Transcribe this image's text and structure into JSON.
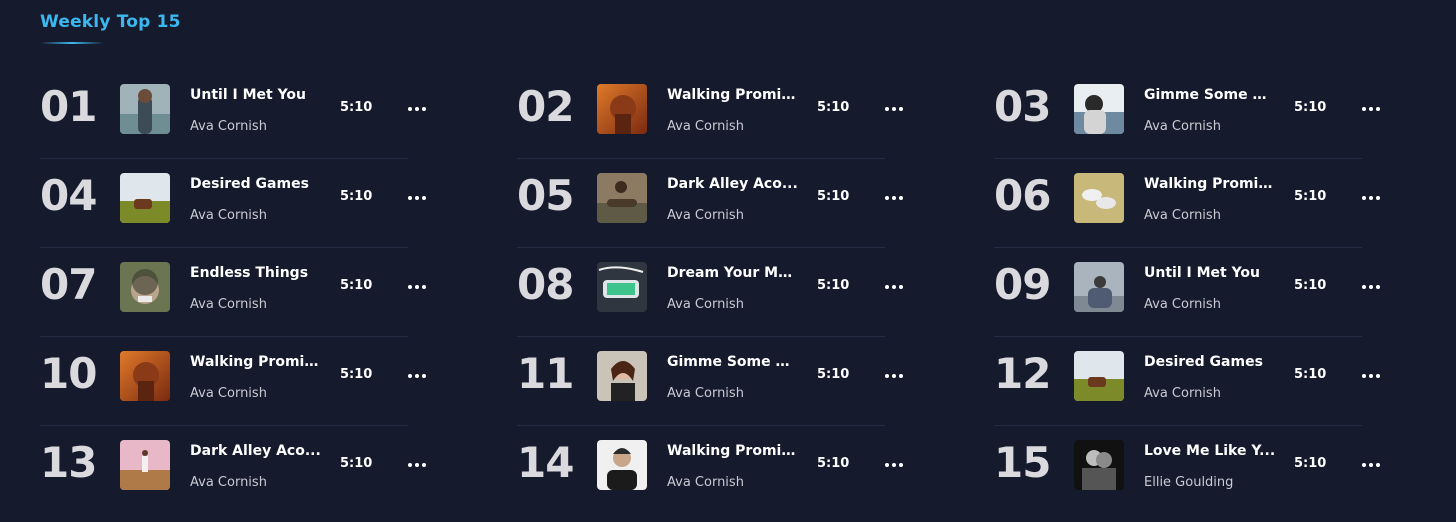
{
  "section": {
    "title": "Weekly Top 15"
  },
  "colors": {
    "background": "#161a2d",
    "accent": "#3bb8f0",
    "divider": "#262b44"
  },
  "tracks": [
    {
      "rank": "01",
      "title": "Until I Met You",
      "artist": "Ava Cornish",
      "duration": "5:10",
      "cover": "woman-by-lake"
    },
    {
      "rank": "02",
      "title": "Walking Promises",
      "artist": "Ava Cornish",
      "duration": "5:10",
      "cover": "man-orange-portrait"
    },
    {
      "rank": "03",
      "title": "Gimme Some Cou...",
      "artist": "Ava Cornish",
      "duration": "5:10",
      "cover": "woman-by-sea"
    },
    {
      "rank": "04",
      "title": "Desired Games",
      "artist": "Ava Cornish",
      "duration": "5:10",
      "cover": "field-landscape"
    },
    {
      "rank": "05",
      "title": "Dark Alley Aco...",
      "artist": "Ava Cornish",
      "duration": "5:10",
      "cover": "man-with-guitar"
    },
    {
      "rank": "06",
      "title": "Walking Promises",
      "artist": "Ava Cornish",
      "duration": "5:10",
      "cover": "sneakers-on-grass"
    },
    {
      "rank": "07",
      "title": "Endless Things",
      "artist": "Ava Cornish",
      "duration": "5:10",
      "cover": "man-in-foliage"
    },
    {
      "rank": "08",
      "title": "Dream Your Mom...",
      "artist": "Ava Cornish",
      "duration": "5:10",
      "cover": "phone-with-earphones"
    },
    {
      "rank": "09",
      "title": "Until I Met You",
      "artist": "Ava Cornish",
      "duration": "5:10",
      "cover": "person-with-camera"
    },
    {
      "rank": "10",
      "title": "Walking Promises",
      "artist": "Ava Cornish",
      "duration": "5:10",
      "cover": "man-orange-portrait"
    },
    {
      "rank": "11",
      "title": "Gimme Some Cou...",
      "artist": "Ava Cornish",
      "duration": "5:10",
      "cover": "woman-portrait"
    },
    {
      "rank": "12",
      "title": "Desired Games",
      "artist": "Ava Cornish",
      "duration": "5:10",
      "cover": "field-landscape"
    },
    {
      "rank": "13",
      "title": "Dark Alley Aco...",
      "artist": "Ava Cornish",
      "duration": "5:10",
      "cover": "girl-in-sunset-field"
    },
    {
      "rank": "14",
      "title": "Walking Promises",
      "artist": "Ava Cornish",
      "duration": "5:10",
      "cover": "man-dark-shirt"
    },
    {
      "rank": "15",
      "title": "Love Me Like Y...",
      "artist": "Ellie Goulding",
      "duration": "5:10",
      "cover": "couple-black-white"
    }
  ]
}
